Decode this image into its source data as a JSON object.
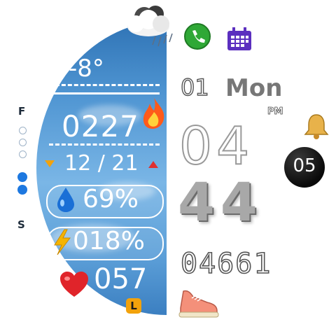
{
  "weather": {
    "temperature": "-8°",
    "icon": "cloud-rain-icon"
  },
  "calories": {
    "value": "0227",
    "icon": "flame-icon"
  },
  "temp_range": {
    "low_icon": "arrow-down-orange",
    "value": "12 / 21",
    "high_icon": "arrow-up-red"
  },
  "humidity": {
    "value": "69%",
    "icon": "water-drop-icon"
  },
  "battery": {
    "value": "018%",
    "icon": "lightning-icon"
  },
  "heart_rate": {
    "value": "057",
    "icon": "heart-icon",
    "level_badge": "L"
  },
  "side": {
    "top_letter": "F",
    "bottom_letter": "S"
  },
  "apps": {
    "phone_icon": "phone-icon",
    "calendar_icon": "calendar-icon"
  },
  "date": {
    "day": "01",
    "weekday": "Mon"
  },
  "time": {
    "ampm": "PM",
    "hour": "04",
    "minute": "44",
    "second": "05",
    "alarm_icon": "bell-icon"
  },
  "steps": {
    "value": "04661",
    "icon": "sneaker-icon"
  },
  "colors": {
    "panel_blue": "#4f95d2",
    "dot_blue": "#1d78e0",
    "badge_orange": "#f2a20c",
    "phone_green": "#2fa836",
    "calendar_purple": "#5b2fbf"
  }
}
